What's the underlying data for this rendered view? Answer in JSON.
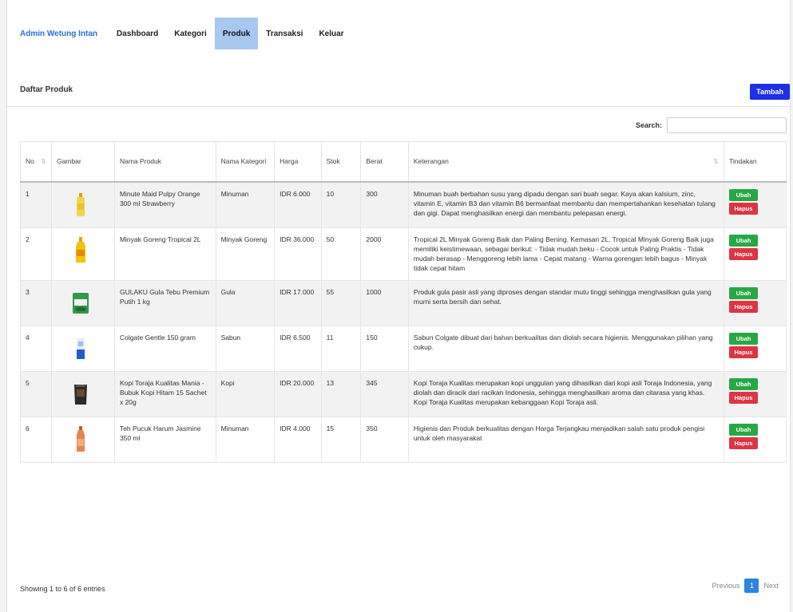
{
  "navbar": {
    "brand": "Admin Wetung Intan",
    "links": [
      "Dashboard",
      "Kategori",
      "Produk",
      "Transaksi",
      "Keluar"
    ],
    "active_index": 2
  },
  "page": {
    "title": "Daftar Produk",
    "add_label": "Tambah"
  },
  "search": {
    "label": "Search:",
    "value": ""
  },
  "table": {
    "columns": [
      "No",
      "Gambar",
      "Nama Produk",
      "Nama Kategori",
      "Harga",
      "Stok",
      "Berat",
      "Keterangan",
      "Tindakan"
    ],
    "rows": [
      {
        "no": "1",
        "image": "bottle-icon",
        "nama": "Minute Maid Pulpy Orange 300 ml Strawberry",
        "kategori": "Minuman",
        "harga": "IDR 6.000",
        "stok": "10",
        "berat": "300",
        "keterangan": "Minuman buah berbahan susu yang dipadu dengan sari buah segar. Kaya akan kalsium, zinc, vitamin E, vitamin B3 dan vitamin B6 bermanfaat membantu dan mempertahankan kesehatan tulang dan gigi. Dapat menghasilkan energi dan membantu pelepasan energi."
      },
      {
        "no": "2",
        "image": "oil-bottle-icon",
        "nama": "Minyak Goreng Tropical 2L",
        "kategori": "Minyak Goreng",
        "harga": "IDR 36.000",
        "stok": "50",
        "berat": "2000",
        "keterangan": "Tropical 2L Minyak Goreng Baik dan Paling Bening. Kemasan 2L. Tropical Minyak Goreng Baik juga memiliki keistimewaan, sebagai berikut: - Tidak mudah beku - Cocok untuk Paling Praktis - Tidak mudah berasap - Menggoreng lebih lama - Cepat matang - Warna gorengan lebih bagus - Minyak tidak cepat hitam"
      },
      {
        "no": "3",
        "image": "sugar-pack-icon",
        "nama": "GULAKU Gula Tebu Premium Putih 1 kg",
        "kategori": "Gula",
        "harga": "IDR 17.000",
        "stok": "55",
        "berat": "1000",
        "keterangan": "Produk gula pasir asli yang diproses dengan standar mutu tinggi sehingga menghasilkan gula yang murni serta bersih dan sehat."
      },
      {
        "no": "4",
        "image": "toothpaste-icon",
        "nama": "Colgate Gentle 150 gram",
        "kategori": "Sabun",
        "harga": "IDR 6.500",
        "stok": "11",
        "berat": "150",
        "keterangan": "Sabun Colgate dibuat dari bahan berkualitas dan diolah secara higienis. Menggunakan pilihan yang cukup."
      },
      {
        "no": "5",
        "image": "coffee-pouch-icon",
        "nama": "Kopi Toraja Kualitas Mania - Bubuk Kopi Hitam 15 Sachet x 20g",
        "kategori": "Kopi",
        "harga": "IDR 20.000",
        "stok": "13",
        "berat": "345",
        "keterangan": "Kopi Toraja Kualitas merupakan kopi unggulan yang dihasilkan dari kopi asli Toraja Indonesia, yang diolah dan diracik dari racikan Indonesia, sehingga menghasilkan aroma dan citarasa yang khas. Kopi Toraja Kualitas merupakan kebanggaan Kopi Toraja asli."
      },
      {
        "no": "6",
        "image": "tea-bottle-icon",
        "nama": "Teh Pucuk Harum Jasmine 350 ml",
        "kategori": "Minuman",
        "harga": "IDR 4.000",
        "stok": "15",
        "berat": "350",
        "keterangan": "Higienis dan Produk berkualitas dengan Harga Terjangkau menjadikan salah satu produk pengisi untuk oleh masyarakat"
      }
    ],
    "action_edit": "Ubah",
    "action_delete": "Hapus"
  },
  "footer": {
    "info": "Showing 1 to 6 of 6 entries",
    "prev": "Previous",
    "current_page": "1",
    "next": "Next"
  },
  "colors": {
    "brand_link": "#2b6fd6",
    "nav_active_bg": "#a9c8ef",
    "add_button": "#1c30e6",
    "edit_button": "#28a745",
    "delete_button": "#dc3545",
    "page_current": "#2b84e0"
  }
}
